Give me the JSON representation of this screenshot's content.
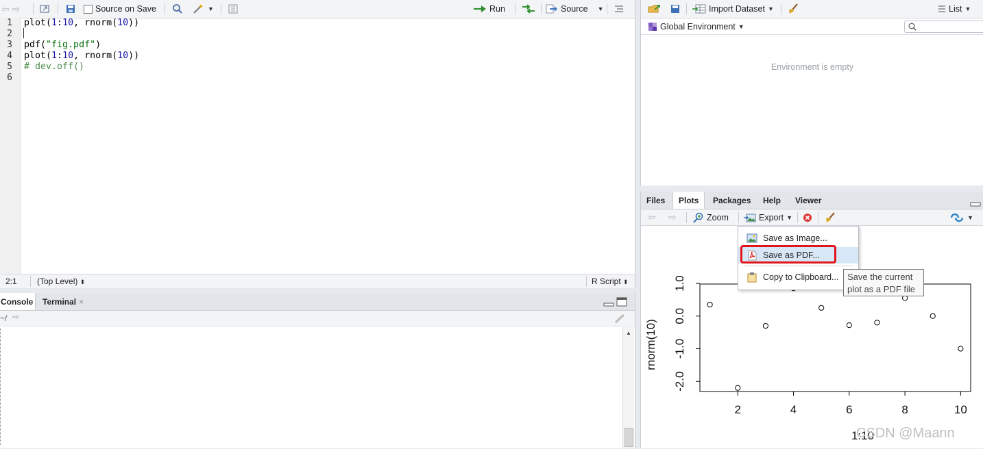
{
  "editor": {
    "toolbar": {
      "source_on_save": "Source on Save",
      "run": "Run",
      "source": "Source"
    },
    "line_numbers": [
      "1",
      "2",
      "3",
      "4",
      "5",
      "6"
    ],
    "code_lines": [
      [
        {
          "t": "plot(",
          "c": ""
        },
        {
          "t": "1",
          "c": "num"
        },
        {
          "t": ":",
          "c": ""
        },
        {
          "t": "10",
          "c": "num"
        },
        {
          "t": ", rnorm(",
          "c": ""
        },
        {
          "t": "10",
          "c": "num"
        },
        {
          "t": "))",
          "c": ""
        }
      ],
      [],
      [
        {
          "t": "pdf(",
          "c": ""
        },
        {
          "t": "\"fig.pdf\"",
          "c": "str"
        },
        {
          "t": ")",
          "c": ""
        }
      ],
      [
        {
          "t": "plot(",
          "c": ""
        },
        {
          "t": "1",
          "c": "num"
        },
        {
          "t": ":",
          "c": ""
        },
        {
          "t": "10",
          "c": "num"
        },
        {
          "t": ", rnorm(",
          "c": ""
        },
        {
          "t": "10",
          "c": "num"
        },
        {
          "t": "))",
          "c": ""
        }
      ],
      [
        {
          "t": "# dev.off()",
          "c": "cmt"
        }
      ],
      []
    ],
    "status": {
      "position": "2:1",
      "scope": "(Top Level)",
      "file_type": "R Script"
    }
  },
  "console": {
    "tabs": [
      "Console",
      "Terminal"
    ],
    "path": "~/"
  },
  "environment": {
    "import_dataset": "Import Dataset",
    "view_mode": "List",
    "scope": "Global Environment",
    "empty_message": "Environment is empty"
  },
  "plots": {
    "tabs": [
      "Files",
      "Plots",
      "Packages",
      "Help",
      "Viewer"
    ],
    "active_tab": "Plots",
    "zoom": "Zoom",
    "export": "Export",
    "export_menu": [
      "Save as Image...",
      "Save as PDF...",
      "Copy to Clipboard..."
    ],
    "highlighted_item": "Save as PDF...",
    "tooltip": [
      "Save the current",
      "plot as a PDF file"
    ]
  },
  "watermark": "CSDN @Maann",
  "chart_data": {
    "type": "scatter",
    "xlabel": "1:10",
    "ylabel": "rnorm(10)",
    "x": [
      1,
      2,
      3,
      4,
      5,
      6,
      7,
      8,
      9,
      10
    ],
    "y": [
      0.35,
      -2.2,
      -0.3,
      0.85,
      0.25,
      -0.28,
      -0.2,
      0.55,
      0.0,
      -1.0
    ],
    "x_ticks": [
      "2",
      "4",
      "6",
      "8",
      "10"
    ],
    "y_ticks": [
      "-2.0",
      "-1.0",
      "0.0",
      "1.0"
    ],
    "xlim": [
      0.64,
      10.36
    ],
    "ylim": [
      -2.31,
      0.98
    ]
  }
}
